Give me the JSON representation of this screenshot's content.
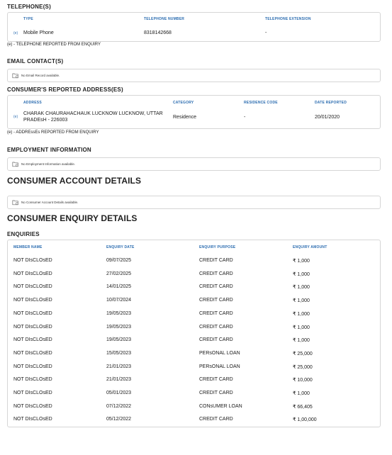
{
  "telephone": {
    "title": "TELEPHONE(S)",
    "headers": [
      "TYPE",
      "TELEPHONE NUMBER",
      "TELEPHONE EXTENSION"
    ],
    "rows": [
      {
        "mark": "(e)",
        "type": "Mobile Phone",
        "number": "8318142668",
        "extension": "-"
      }
    ],
    "note": "(e) - TELEPHONE REPORTED FROM ENQUIRY"
  },
  "email": {
    "title": "EMAIL CONTACT(S)",
    "empty_text": "No Email Record available."
  },
  "address": {
    "title": "CONSUMER'S REPORTED ADDRESS(ES)",
    "headers": [
      "ADDRESS",
      "CATEGORY",
      "RESIDENCE CODE",
      "DATE REPORTED"
    ],
    "rows": [
      {
        "mark": "(e)",
        "line1": "CHARAK CHAURAHACHAUK LUCKNOW LUCKNOW, UTTAR",
        "line2": "PRADEsH - 226003",
        "category": "Residence",
        "residence_code": "-",
        "date": "20/01/2020"
      }
    ],
    "note": "(e) - ADDREssEs REPORTED FROM ENQUIRY"
  },
  "employment": {
    "title": "EMPLOYMENT INFORMATION",
    "empty_text": "No Employment Information available."
  },
  "account": {
    "title": "CONSUMER ACCOUNT DETAILS",
    "empty_text": "No Consumer Account Details available."
  },
  "enquiry": {
    "title": "CONSUMER ENQUIRY DETAILS",
    "subtitle": "ENQUIRIES",
    "headers": [
      "MEMBER NAME",
      "ENQUIRY DATE",
      "ENQUIRY PURPOSE",
      "ENQUIRY AMOUNT"
    ],
    "rows": [
      {
        "member": "NOT DIsCLOsED",
        "date": "09/07/2025",
        "purpose": "CREDIT CARD",
        "amount": "₹ 1,000"
      },
      {
        "member": "NOT DIsCLOsED",
        "date": "27/02/2025",
        "purpose": "CREDIT CARD",
        "amount": "₹ 1,000"
      },
      {
        "member": "NOT DIsCLOsED",
        "date": "14/01/2025",
        "purpose": "CREDIT CARD",
        "amount": "₹ 1,000"
      },
      {
        "member": "NOT DIsCLOsED",
        "date": "10/07/2024",
        "purpose": "CREDIT CARD",
        "amount": "₹ 1,000"
      },
      {
        "member": "NOT DIsCLOsED",
        "date": "19/05/2023",
        "purpose": "CREDIT CARD",
        "amount": "₹ 1,000"
      },
      {
        "member": "NOT DIsCLOsED",
        "date": "19/05/2023",
        "purpose": "CREDIT CARD",
        "amount": "₹ 1,000"
      },
      {
        "member": "NOT DIsCLOsED",
        "date": "19/05/2023",
        "purpose": "CREDIT CARD",
        "amount": "₹ 1,000"
      },
      {
        "member": "NOT DIsCLOsED",
        "date": "15/05/2023",
        "purpose": "PERsONAL LOAN",
        "amount": "₹ 25,000"
      },
      {
        "member": "NOT DIsCLOsED",
        "date": "21/01/2023",
        "purpose": "PERsONAL LOAN",
        "amount": "₹ 25,000"
      },
      {
        "member": "NOT DIsCLOsED",
        "date": "21/01/2023",
        "purpose": "CREDIT CARD",
        "amount": "₹ 10,000"
      },
      {
        "member": "NOT DIsCLOsED",
        "date": "05/01/2023",
        "purpose": "CREDIT CARD",
        "amount": "₹ 1,000"
      },
      {
        "member": "NOT DIsCLOsED",
        "date": "07/12/2022",
        "purpose": "CONsUMER LOAN",
        "amount": "₹ 66,405"
      },
      {
        "member": "NOT DIsCLOsED",
        "date": "05/12/2022",
        "purpose": "CREDIT CARD",
        "amount": "₹ 1,00,000"
      }
    ]
  },
  "colors": {
    "header_blue": "#2b6cb0",
    "border": "#d6d6d6"
  },
  "icons": {
    "empty_state": "folder-clock-icon"
  }
}
